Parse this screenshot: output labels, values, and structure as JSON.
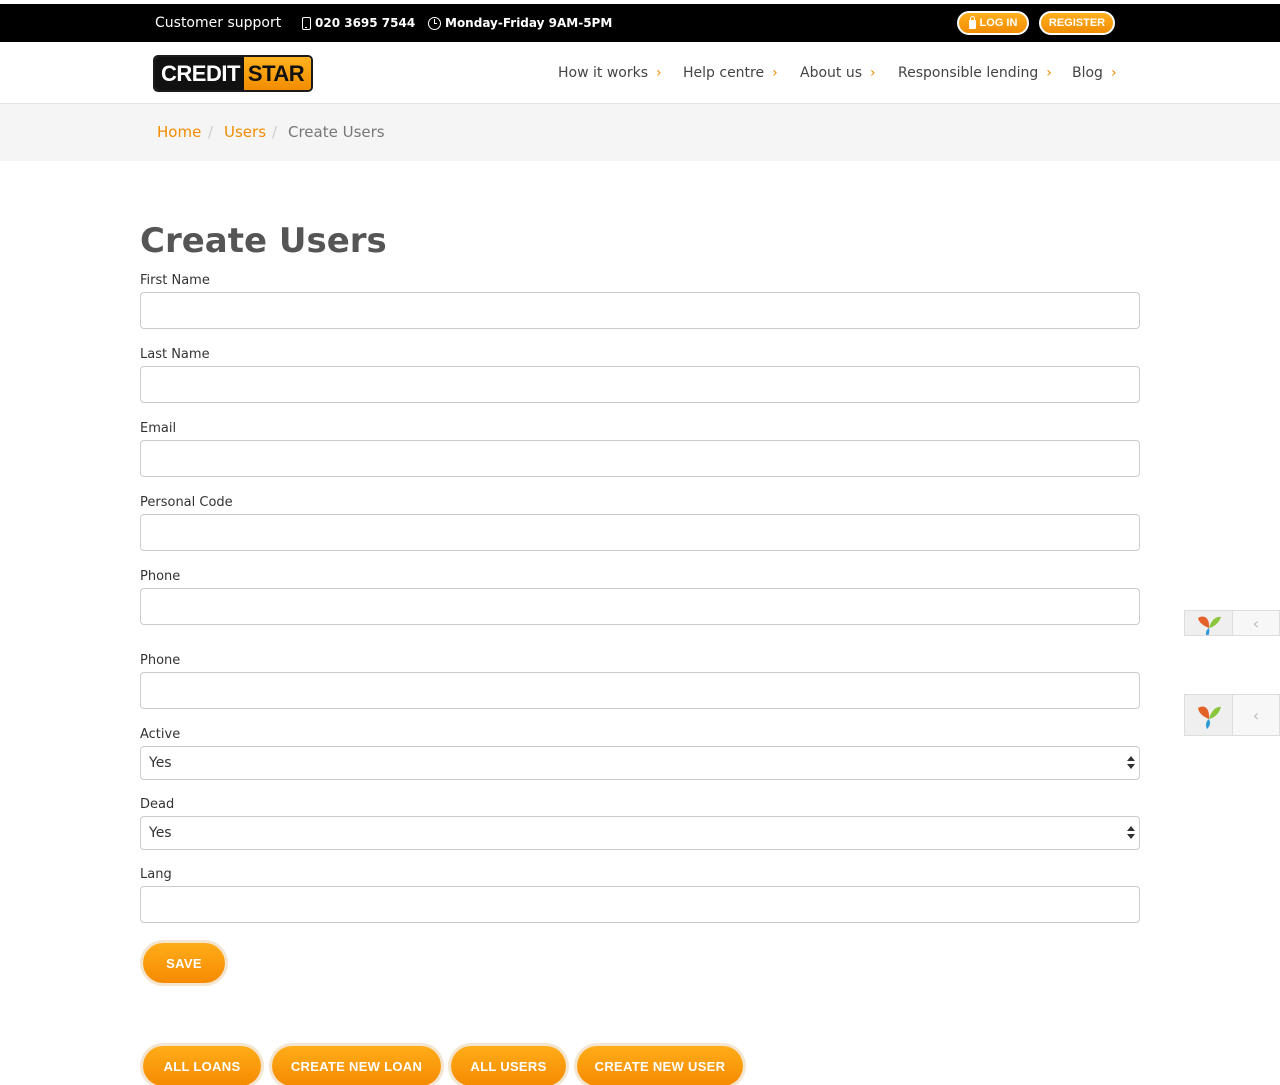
{
  "topbar": {
    "support_label": "Customer support",
    "phone": "020 3695 7544",
    "hours": "Monday-Friday 9AM-5PM",
    "login_label": "LOG IN",
    "register_label": "REGISTER"
  },
  "brand": {
    "part1": "CREDIT",
    "part2": "STAR"
  },
  "nav": [
    {
      "label": "How it works",
      "chev": "›"
    },
    {
      "label": "Help centre",
      "chev": "›"
    },
    {
      "label": "About us",
      "chev": "›"
    },
    {
      "label": "Responsible lending",
      "chev": "›"
    },
    {
      "label": "Blog",
      "chev": "›"
    }
  ],
  "breadcrumb": {
    "home": "Home",
    "users": "Users",
    "current": "Create Users",
    "sep": "/"
  },
  "form": {
    "title": "Create Users",
    "fields": [
      {
        "label": "First Name",
        "value": ""
      },
      {
        "label": "Last Name",
        "value": ""
      },
      {
        "label": "Email",
        "value": ""
      },
      {
        "label": "Personal Code",
        "value": ""
      },
      {
        "label": "Phone",
        "value": ""
      },
      {
        "label": "Phone",
        "value": ""
      },
      {
        "label": "Active",
        "value": "Yes"
      },
      {
        "label": "Dead",
        "value": "Yes"
      },
      {
        "label": "Lang",
        "value": ""
      }
    ],
    "save_label": "SAVE"
  },
  "actions": {
    "all_loans": "ALL LOANS",
    "create_new_loan": "CREATE NEW LOAN",
    "all_users": "ALL USERS",
    "create_new_user": "CREATE NEW USER"
  },
  "debug_toggle": "‹",
  "colors": {
    "accent": "#f28c00",
    "topbar": "#000000",
    "title": "#555555"
  }
}
